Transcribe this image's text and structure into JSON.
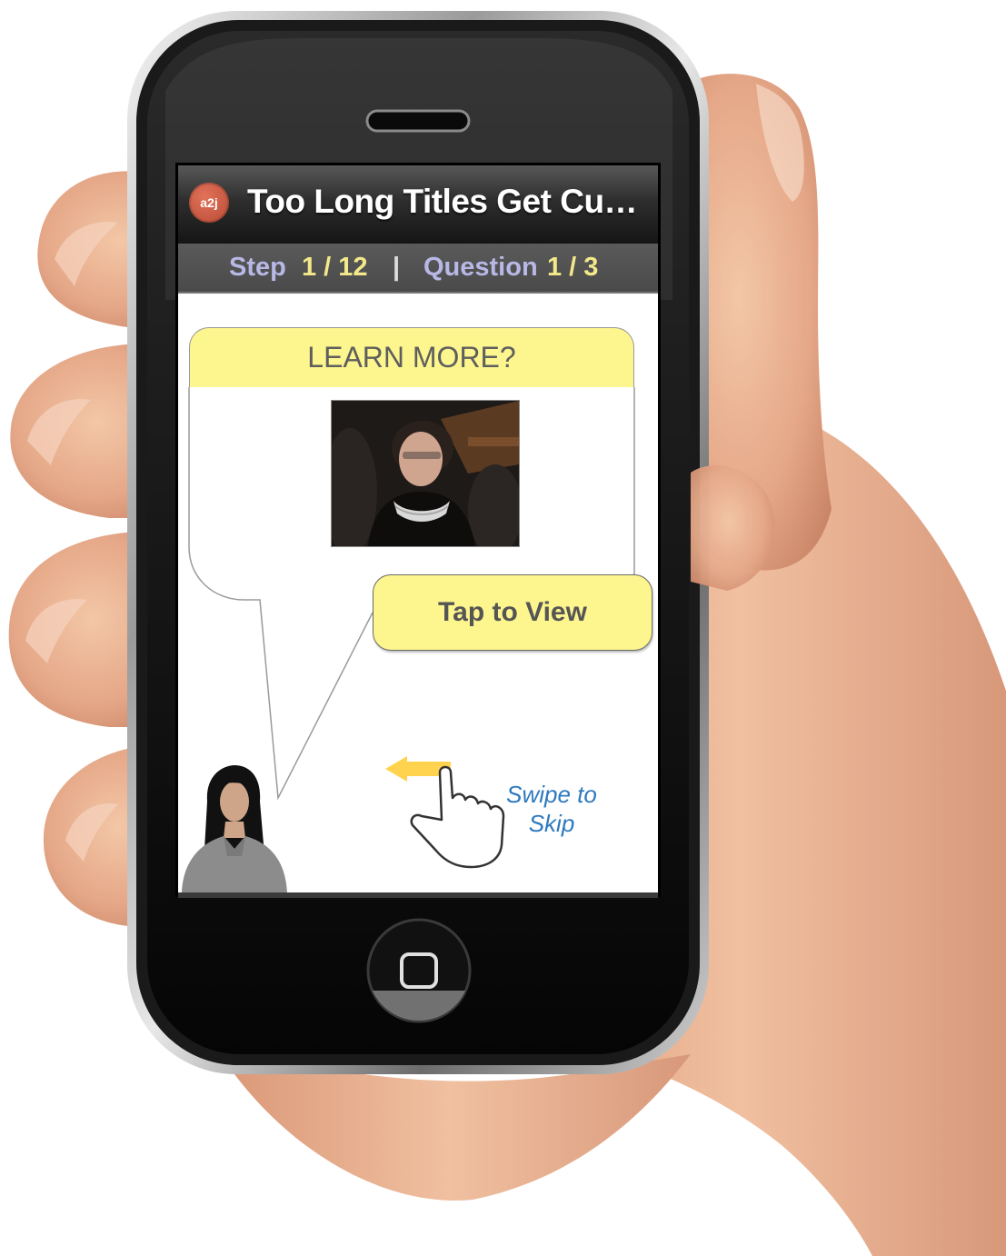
{
  "app": {
    "logo_text": "a2j",
    "title": "Too Long Titles Get Cu…"
  },
  "progress": {
    "step_label": "Step",
    "step_value": "1 / 12",
    "separator": "|",
    "question_label": "Question",
    "question_value": "1 / 3"
  },
  "panel": {
    "header": "LEARN MORE?",
    "action_button": "Tap to View"
  },
  "hint": {
    "line1": "Swipe to",
    "line2": "Skip"
  },
  "colors": {
    "accent_yellow": "#fdf58d",
    "logo": "#c9583e",
    "hint_blue": "#2e79bf"
  },
  "icons": [
    "home-button-icon",
    "swipe-hand-icon",
    "left-arrow-icon",
    "avatar-icon"
  ]
}
